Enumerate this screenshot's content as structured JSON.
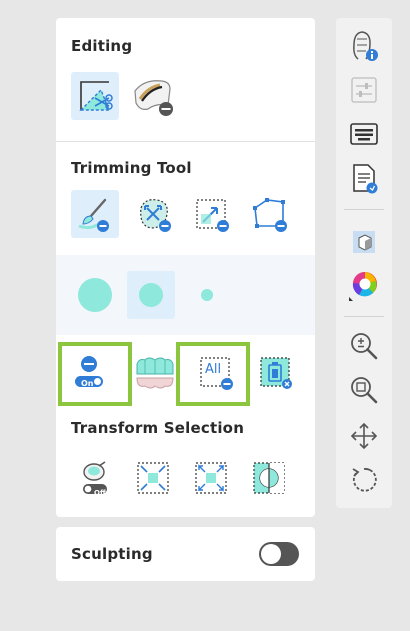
{
  "editing": {
    "title": "Editing"
  },
  "trimming": {
    "title": "Trimming Tool"
  },
  "toggle_on_label": "On",
  "select_all_label": "All",
  "transform": {
    "title": "Transform Selection",
    "toggle_off_label": "Off"
  },
  "sculpting": {
    "title": "Sculpting",
    "enabled": false
  },
  "colors": {
    "accent_blue": "#2f7dd6",
    "teal_fill": "#8ee8dc",
    "highlight_green": "#8cc63f",
    "active_bg": "#dfeefb"
  },
  "icons": [
    "trim-scissors-icon",
    "remove-material-icon",
    "brush-trim-icon",
    "lasso-trim-icon",
    "box-trim-icon",
    "polygon-trim-icon",
    "large-brush-icon",
    "medium-brush-icon",
    "small-brush-icon",
    "toggle-on-icon",
    "teeth-selection-icon",
    "select-all-icon",
    "delete-selection-icon",
    "transform-off-icon",
    "shrink-selection-icon",
    "expand-selection-icon",
    "invert-selection-icon",
    "scan-info-icon",
    "sliders-icon",
    "keyboard-icon",
    "document-icon",
    "cube-view-icon",
    "color-wheel-icon",
    "zoom-in-icon",
    "zoom-fit-icon",
    "move-icon",
    "rotate-icon"
  ]
}
